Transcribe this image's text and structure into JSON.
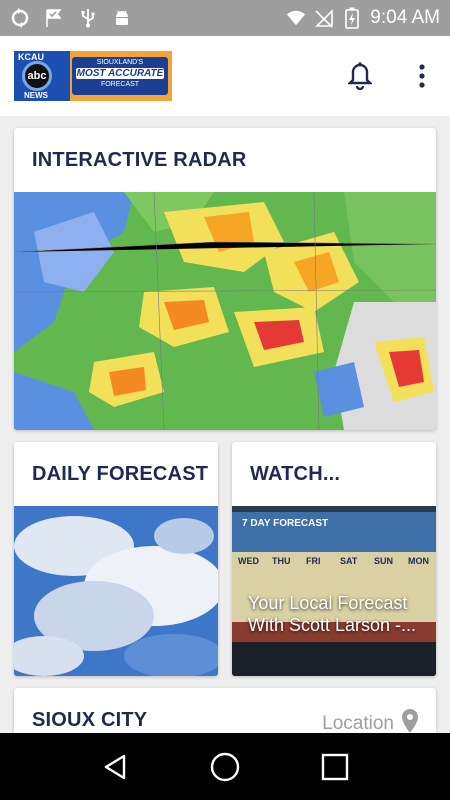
{
  "status_bar": {
    "time": "9:04 AM",
    "left_icons": [
      "sync-icon",
      "check-flag-icon",
      "usb-icon",
      "android-icon"
    ],
    "right_icons": [
      "wifi-icon",
      "no-sim-icon",
      "battery-charging-icon"
    ]
  },
  "app_bar": {
    "logo": {
      "station": "KCAU",
      "network": "abc",
      "news": "NEWS",
      "line1": "SIOUXLAND'S",
      "line2": "MOST ACCURATE",
      "line3": "FORECAST"
    },
    "actions": [
      "bell-icon",
      "more-vert-icon"
    ]
  },
  "cards": {
    "radar": {
      "title": "INTERACTIVE RADAR"
    },
    "daily_forecast": {
      "title": "DAILY FORECAST"
    },
    "watch": {
      "title": "WATCH...",
      "video_caption": "Your Local Forecast With Scott Larson -...",
      "video_overlay_title": "7 DAY FORECAST",
      "video_days": [
        "WED",
        "THU",
        "FRI",
        "SAT",
        "SUN",
        "MON"
      ]
    },
    "city": {
      "title": "SIOUX CITY",
      "location_label": "Location"
    }
  },
  "nav_bar": {
    "buttons": [
      "back-icon",
      "home-icon",
      "recents-icon"
    ]
  },
  "colors": {
    "status_bar": "#9e9e9e",
    "title_text": "#1e2a52",
    "accent_blue": "#1d3f93",
    "nav_bar": "#000000"
  }
}
